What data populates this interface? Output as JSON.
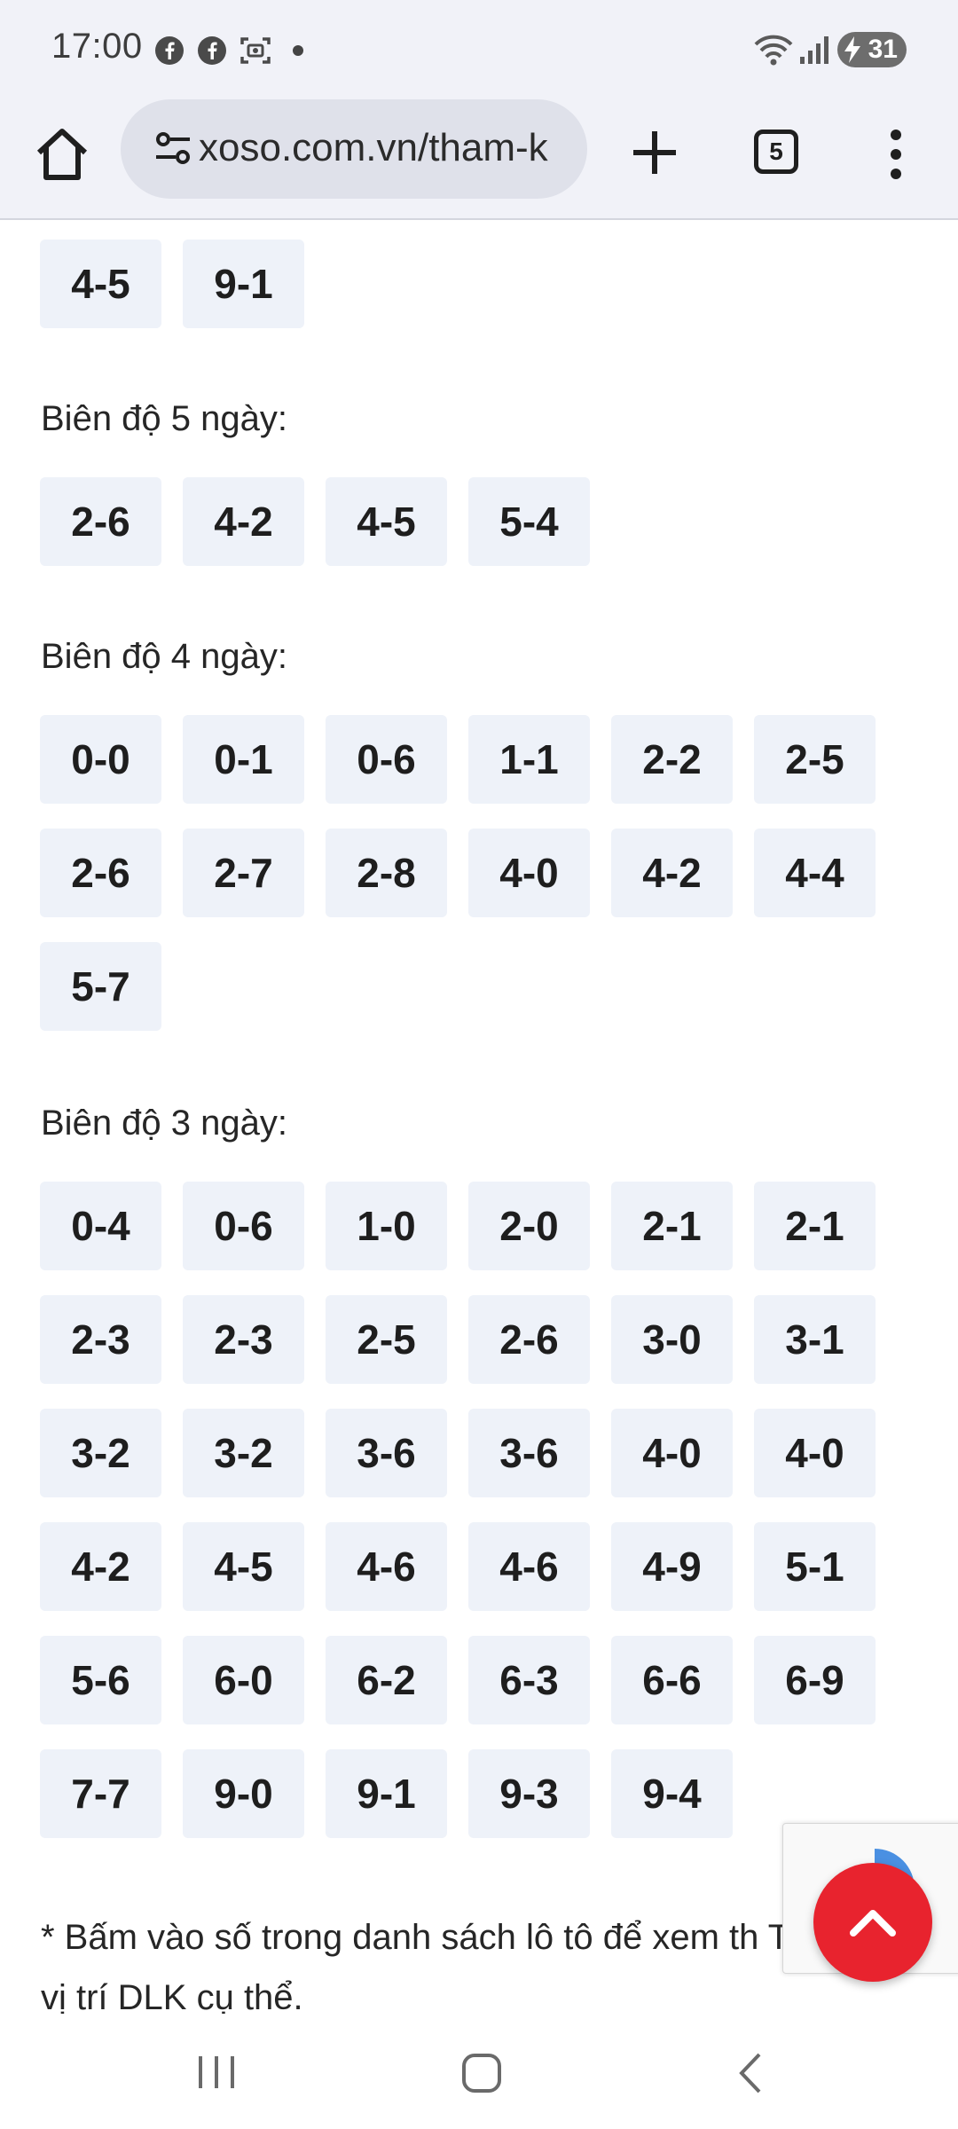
{
  "status_bar": {
    "time": "17:00",
    "battery": "31",
    "notification_icons": [
      "facebook-icon",
      "facebook-icon",
      "screenshot-icon"
    ]
  },
  "browser": {
    "url": "xoso.com.vn/tham-k",
    "tab_count": "5"
  },
  "sections": [
    {
      "heading": "",
      "items": [
        "4-5",
        "9-1"
      ]
    },
    {
      "heading": "Biên độ 5 ngày:",
      "items": [
        "2-6",
        "4-2",
        "4-5",
        "5-4"
      ]
    },
    {
      "heading": "Biên độ 4 ngày:",
      "items": [
        "0-0",
        "0-1",
        "0-6",
        "1-1",
        "2-2",
        "2-5",
        "2-6",
        "2-7",
        "2-8",
        "4-0",
        "4-2",
        "4-4",
        "5-7"
      ]
    },
    {
      "heading": "Biên độ 3 ngày:",
      "items": [
        "0-4",
        "0-6",
        "1-0",
        "2-0",
        "2-1",
        "2-1",
        "2-3",
        "2-3",
        "2-5",
        "2-6",
        "3-0",
        "3-1",
        "3-2",
        "3-2",
        "3-6",
        "3-6",
        "4-0",
        "4-0",
        "4-2",
        "4-5",
        "4-6",
        "4-6",
        "4-9",
        "5-1",
        "5-6",
        "6-0",
        "6-2",
        "6-3",
        "6-6",
        "6-9",
        "7-7",
        "9-0",
        "9-1",
        "9-3",
        "9-4"
      ]
    }
  ],
  "footnote": "* Bấm vào số trong danh sách lô tô để xem th Thống kê vị trí DLK cụ thể.",
  "colors": {
    "chip_bg": "#eef2f9",
    "fab": "#e8232e",
    "toolbar_bg": "#f1f2f8"
  }
}
